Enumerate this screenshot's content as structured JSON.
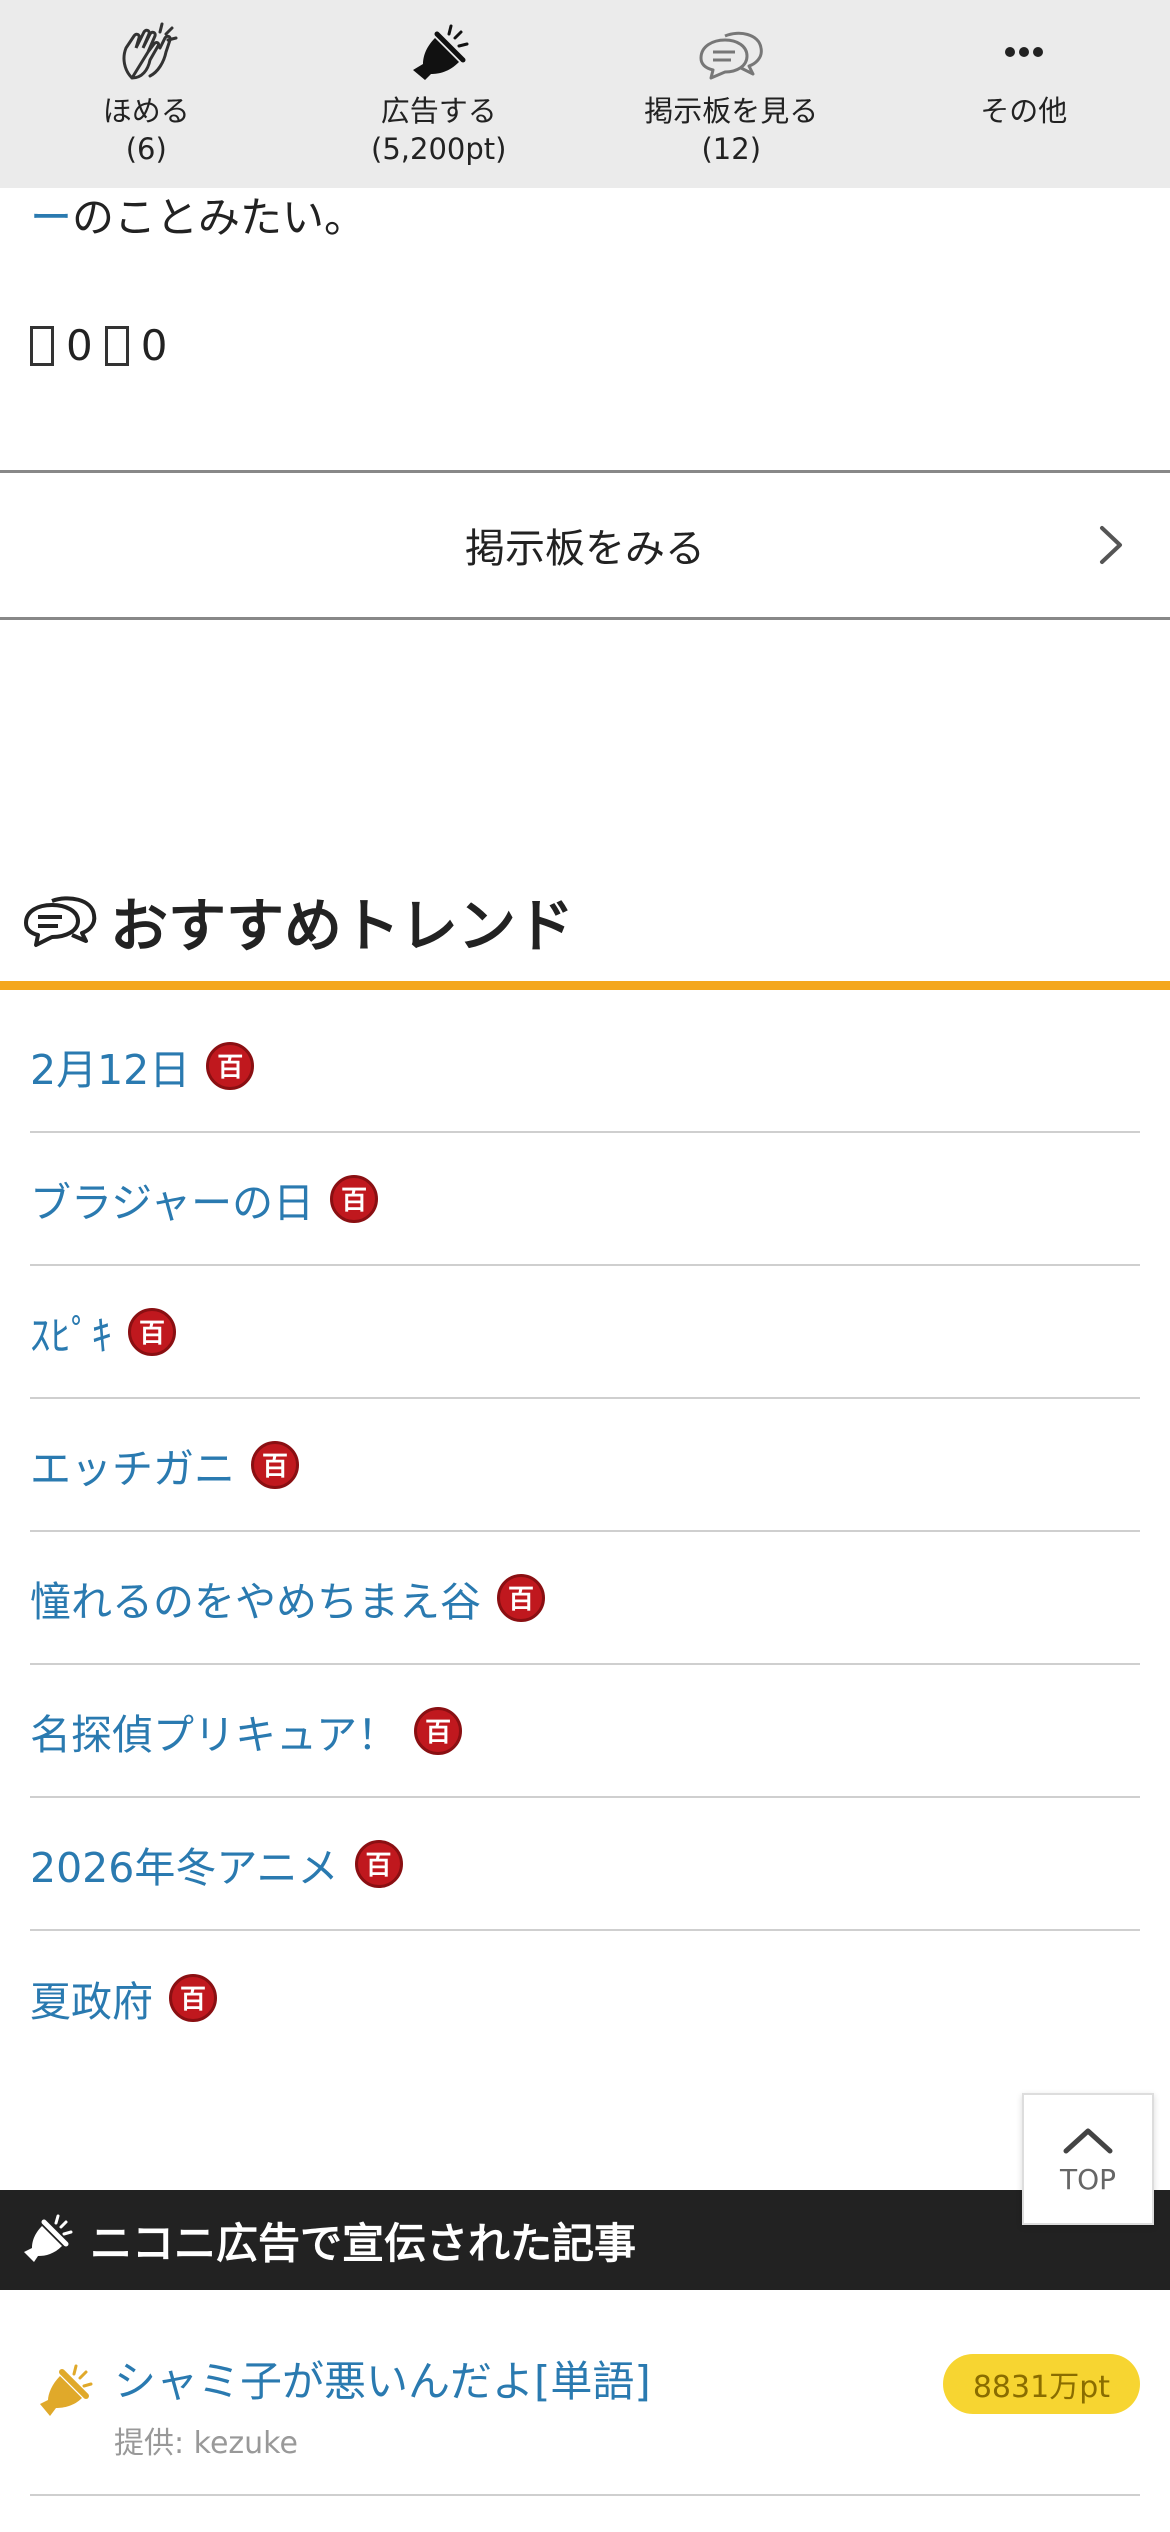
{
  "actions": [
    {
      "label": "ほめる",
      "count": "(6)"
    },
    {
      "label": "広告する",
      "count": "(5,200pt)"
    },
    {
      "label": "掲示板を見る",
      "count": "(12)"
    },
    {
      "label": "その他",
      "count": ""
    }
  ],
  "article": {
    "tail_prefix": "ー",
    "tail_text": "のことみたい。",
    "reaction_good": "0",
    "reaction_bad": "0"
  },
  "board_link": {
    "label": "掲示板をみる"
  },
  "trends": {
    "title": "おすすめトレンド",
    "badge": "百",
    "items": [
      {
        "label": "2月12日"
      },
      {
        "label": "ブラジャーの日"
      },
      {
        "label": "ｽﾋﾟｷ"
      },
      {
        "label": "エッチガニ"
      },
      {
        "label": "憧れるのをやめちまえ谷"
      },
      {
        "label": "名探偵プリキュア！"
      },
      {
        "label": "2026年冬アニメ"
      },
      {
        "label": "夏政府"
      }
    ]
  },
  "top_button": {
    "label": "TOP"
  },
  "nico_ad": {
    "title": "ニコニ広告で宣伝された記事",
    "items": [
      {
        "title": "シャミ子が悪いんだよ[単語]",
        "provider": "提供: kezuke",
        "points": "8831万pt"
      }
    ]
  },
  "colors": {
    "link": "#2a7ab0",
    "accent": "#f4a71d",
    "badge": "#c0181e",
    "ad_header": "#222222",
    "points_pill": "#f7d531"
  }
}
